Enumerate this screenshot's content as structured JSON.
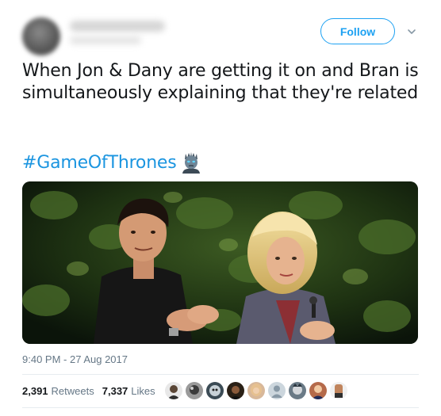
{
  "header": {
    "follow_label": "Follow"
  },
  "tweet": {
    "text": "When Jon & Dany are getting it on and Bran is simultaneously explaining that they're related",
    "hashtag": "#GameOfThrones",
    "timestamp": "9:40 PM - 27 Aug 2017"
  },
  "stats": {
    "retweets_count": "2,391",
    "retweets_label": "Retweets",
    "likes_count": "7,337",
    "likes_label": "Likes"
  },
  "icons": {
    "menu": "chevron-down-icon",
    "hashtag_emoji": "night-king-icon"
  },
  "colors": {
    "accent": "#1da1f2",
    "hashtag": "#1b95e0",
    "muted": "#657786",
    "text": "#14171a"
  }
}
